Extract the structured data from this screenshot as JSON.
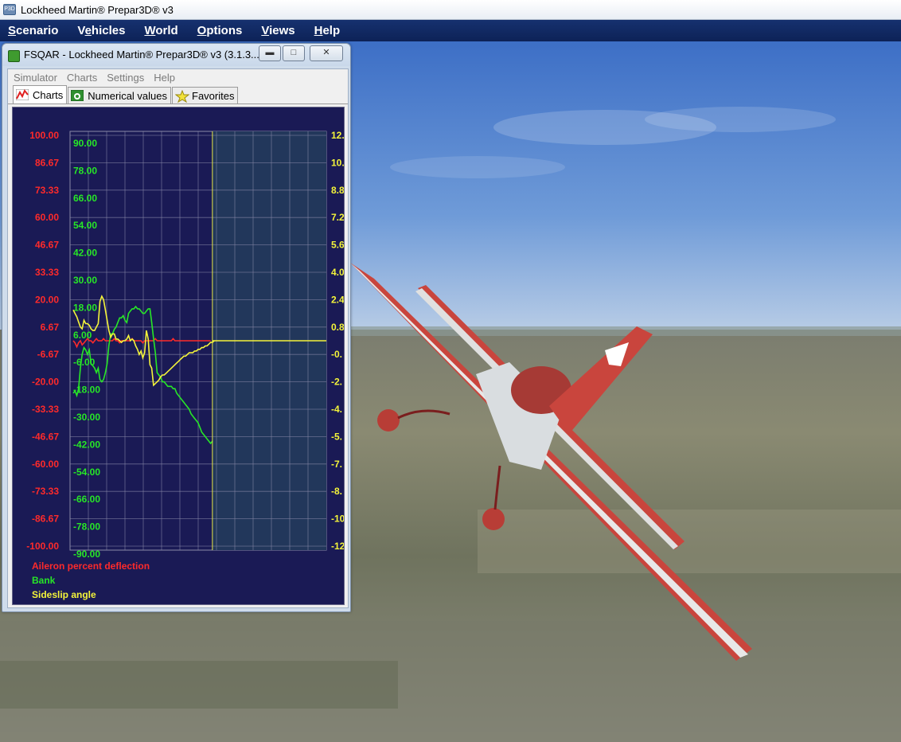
{
  "app": {
    "title": "Lockheed Martin® Prepar3D® v3",
    "icon_name": "prepar3d-app-icon",
    "menu": [
      {
        "label": "Scenario",
        "hotkey": "S"
      },
      {
        "label": "Vehicles",
        "hotkey": "e"
      },
      {
        "label": "World",
        "hotkey": "W"
      },
      {
        "label": "Options",
        "hotkey": "O"
      },
      {
        "label": "Views",
        "hotkey": "V"
      },
      {
        "label": "Help",
        "hotkey": "H"
      }
    ]
  },
  "fsqar": {
    "title": "FSQAR - Lockheed Martin® Prepar3D® v3 (3.1.3....",
    "icon_name": "fsqar-app-icon",
    "window_buttons": {
      "minimize": "minimize-icon",
      "maximize": "restore-icon",
      "close": "close-icon"
    },
    "menu": [
      "Simulator",
      "Charts",
      "Settings",
      "Help"
    ],
    "tabs": [
      {
        "label": "Charts",
        "icon": "line-chart-icon",
        "active": true
      },
      {
        "label": "Numerical values",
        "icon": "numeric-gauge-icon",
        "active": false
      },
      {
        "label": "Favorites",
        "icon": "star-icon",
        "active": false
      }
    ]
  },
  "chart_data": {
    "type": "line",
    "grid": true,
    "background_color": "#1a1a55",
    "cursor_color": "#e8e846",
    "axes": {
      "left_red": {
        "color": "#ff2a2a",
        "ticks": [
          "100.00",
          "86.67",
          "73.33",
          "60.00",
          "46.67",
          "33.33",
          "20.00",
          "6.67",
          "-6.67",
          "-20.00",
          "-33.33",
          "-46.67",
          "-60.00",
          "-73.33",
          "-86.67",
          "-100.00"
        ],
        "range": [
          -100,
          100
        ]
      },
      "left_green": {
        "color": "#27e627",
        "ticks": [
          "90.00",
          "78.00",
          "66.00",
          "54.00",
          "42.00",
          "30.00",
          "18.00",
          "6.00",
          "-6.00",
          "-18.00",
          "-30.00",
          "-42.00",
          "-54.00",
          "-66.00",
          "-78.00",
          "-90.00"
        ],
        "range": [
          -90,
          90
        ]
      },
      "right_yellow": {
        "color": "#f4f43a",
        "ticks": [
          "12.",
          "10.",
          "8.8",
          "7.2",
          "5.6",
          "4.0",
          "2.4",
          "0.8",
          "-0.",
          "-2.",
          "-4.",
          "-5.",
          "-7.",
          "-8.",
          "-10",
          "-12"
        ]
      }
    },
    "x_sample_count": 80,
    "cursor_sample": 78,
    "series": [
      {
        "name": "Aileron percent deflection",
        "color": "#ff2a2a",
        "values": [
          0,
          -1,
          -3,
          -1,
          0,
          -2,
          -1,
          0,
          1,
          0,
          0,
          -1,
          0,
          1,
          0,
          0,
          0,
          1,
          0,
          0,
          0,
          0,
          0,
          1,
          0,
          0,
          -1,
          0,
          0,
          0,
          0,
          0,
          0,
          1,
          0,
          0,
          0,
          0,
          0,
          -1,
          0,
          0,
          0,
          0,
          0,
          0,
          1,
          0,
          0,
          0,
          0,
          0,
          0,
          0,
          0,
          0,
          1,
          0,
          0,
          0,
          0,
          0,
          0,
          0,
          0,
          0,
          0,
          0,
          0,
          0,
          0,
          0,
          0,
          0,
          0,
          0,
          0,
          0
        ]
      },
      {
        "name": "Bank",
        "color": "#27e627",
        "values": [
          -23,
          -22,
          -24,
          -21,
          -12,
          -6,
          -3,
          -4,
          -6,
          -4,
          -10,
          -11,
          -12,
          -14,
          -12,
          -17,
          -18,
          -17,
          -14,
          -10,
          -2,
          3,
          3,
          5,
          6,
          8,
          10,
          10,
          11,
          9,
          8,
          12,
          13,
          14,
          14,
          15,
          14,
          14,
          13,
          12,
          12,
          13,
          14,
          14,
          8,
          1,
          -5,
          -14,
          -15,
          -16,
          -18,
          -18,
          -19,
          -20,
          -20,
          -20,
          -21,
          -21,
          -23,
          -24,
          -25,
          -26,
          -27,
          -28,
          -29,
          -30,
          -32,
          -33,
          -34,
          -35,
          -36,
          -38,
          -40,
          -41,
          -42,
          -43,
          -44,
          -45,
          -44
        ]
      },
      {
        "name": "Sideslip angle",
        "color": "#f4f43a",
        "values": [
          1.8,
          1.6,
          1.4,
          1.1,
          0.8,
          0.7,
          1.2,
          1.0,
          1.0,
          0.9,
          0.7,
          0.6,
          0.6,
          0.8,
          1.0,
          2.3,
          2.6,
          2.4,
          1.8,
          1.2,
          0.6,
          0.2,
          0.4,
          0.4,
          0.1,
          0.1,
          0.0,
          -0.1,
          0.0,
          0.0,
          0.1,
          0.3,
          0.0,
          0.1,
          0.0,
          -0.3,
          -0.5,
          -0.8,
          -0.6,
          -1.0,
          -0.7,
          0.6,
          0.1,
          -1.4,
          -1.6,
          -2.6,
          -2.5,
          -2.4,
          -2.3,
          -2.1,
          -2.0,
          -2.0,
          -1.9,
          -1.8,
          -1.7,
          -1.6,
          -1.5,
          -1.4,
          -1.3,
          -1.2,
          -1.1,
          -1.0,
          -0.9,
          -0.9,
          -0.8,
          -0.7,
          -0.7,
          -0.7,
          -0.6,
          -0.6,
          -0.5,
          -0.5,
          -0.4,
          -0.4,
          -0.3,
          -0.3,
          -0.2,
          -0.1,
          -0.1,
          0.0
        ]
      }
    ]
  }
}
